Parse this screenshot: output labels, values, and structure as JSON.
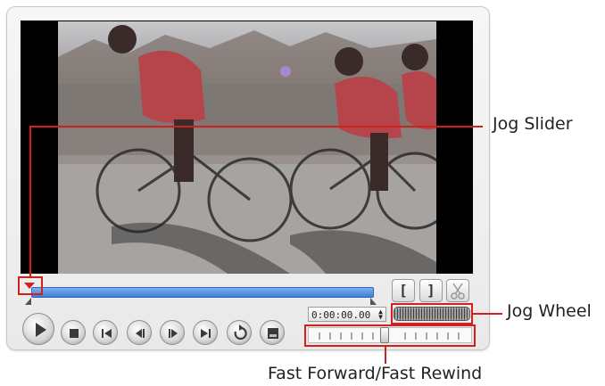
{
  "annotations": {
    "jog_slider": "Jog Slider",
    "jog_wheel": "Jog Wheel",
    "fast_forward_rewind": "Fast Forward/Fast Rewind"
  },
  "controls": {
    "mark_in_label": "[",
    "mark_out_label": "]",
    "timecode": "0:00:00.00"
  },
  "icons": [
    "play-icon",
    "stop-icon",
    "home-icon",
    "previous-frame-icon",
    "next-frame-icon",
    "end-icon",
    "repeat-icon",
    "display-mode-icon",
    "scissors-icon"
  ],
  "colors": {
    "annotation": "#d12020",
    "progress": "#3e7ed9"
  }
}
